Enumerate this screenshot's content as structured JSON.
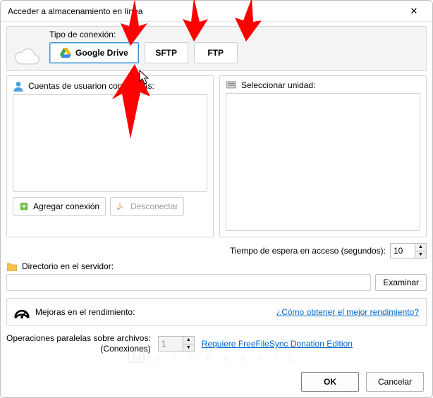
{
  "window": {
    "title": "Acceder a almacenamiento en línea"
  },
  "connection": {
    "type_label": "Tipo de conexión:",
    "buttons": {
      "gdrive": "Google Drive",
      "sftp": "SFTP",
      "ftp": "FTP"
    }
  },
  "accounts": {
    "header": "Cuentas de usuarion conectadas:",
    "add_label": "Agregar conexión",
    "disconnect_label": "Desconectar"
  },
  "drive": {
    "header": "Seleccionar unidad:"
  },
  "timeout": {
    "label": "Tiempo de espera en acceso (segundos):",
    "value": "10"
  },
  "directory": {
    "label": "Directorio en el servidor:",
    "value": "",
    "browse": "Examinar"
  },
  "performance": {
    "label": "Mejoras en el rendimiento:",
    "link": "¿Cómo obtener el mejor rendimiento?"
  },
  "parallel": {
    "line1": "Operaciones paralelas sobre archivos:",
    "line2": "(Conexiones)",
    "value": "1",
    "donation_link": "Requiere FreeFileSync Donation Edition"
  },
  "footer": {
    "ok": "OK",
    "cancel": "Cancelar"
  },
  "watermark": "GEEKNETIC",
  "annotations": {
    "type": "instructional-arrows",
    "color": "#ff0000",
    "arrows": [
      {
        "target": "google-drive-button",
        "from": "above-right"
      },
      {
        "target": "sftp-button",
        "from": "above"
      },
      {
        "target": "ftp-button",
        "from": "above"
      },
      {
        "target": "google-drive-button",
        "from": "below"
      }
    ]
  }
}
